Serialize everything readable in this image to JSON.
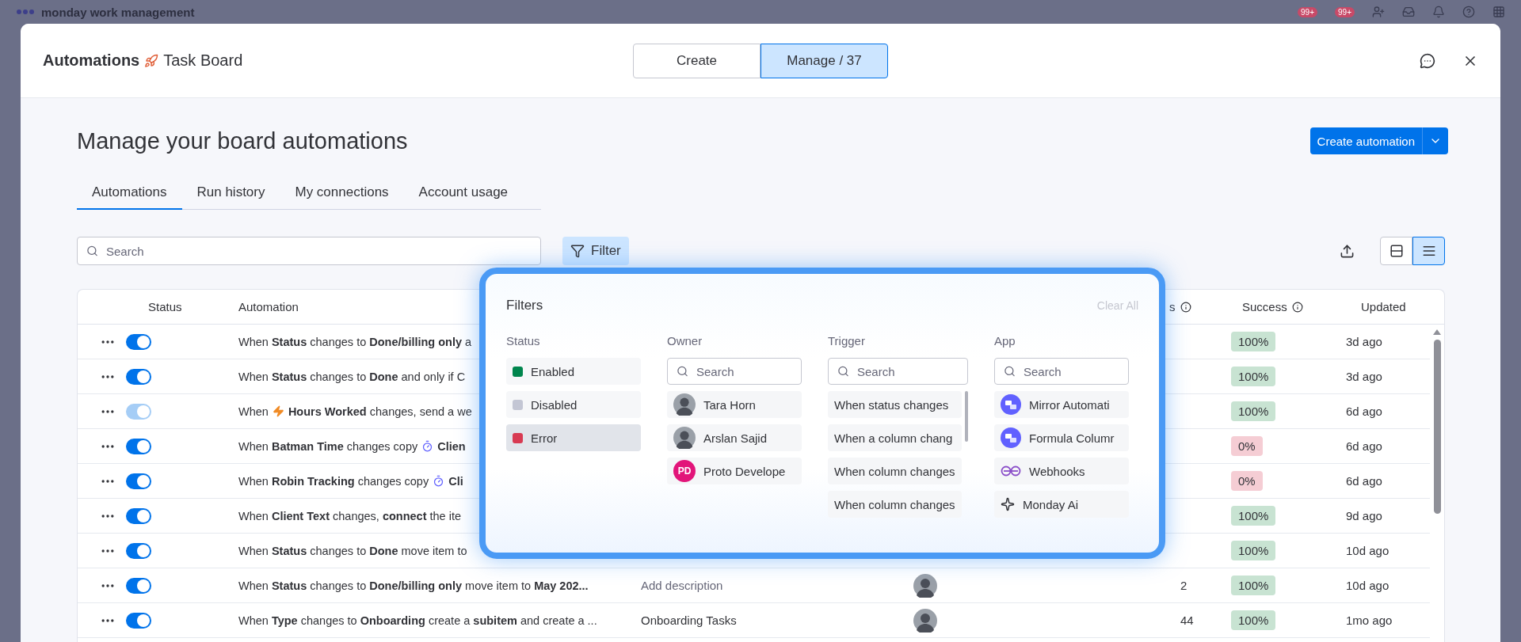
{
  "backdrop": {
    "brand": "monday work management",
    "badges": [
      "99+",
      "99+"
    ]
  },
  "window": {
    "title": "Automations",
    "board": "Task Board"
  },
  "mode_tabs": [
    {
      "label": "Create",
      "selected": false
    },
    {
      "label": "Manage / 37",
      "selected": true
    }
  ],
  "heading": "Manage your board automations",
  "create_button": "Create automation",
  "tabs": [
    {
      "label": "Automations",
      "selected": true
    },
    {
      "label": "Run history",
      "selected": false
    },
    {
      "label": "My connections",
      "selected": false
    },
    {
      "label": "Account usage",
      "selected": false
    }
  ],
  "search": {
    "placeholder": "Search"
  },
  "filter_button": {
    "label": "Filter",
    "active": true
  },
  "views": [
    {
      "kind": "cards",
      "selected": false
    },
    {
      "kind": "list",
      "selected": true
    }
  ],
  "table": {
    "columns": [
      {
        "label": "Status"
      },
      {
        "label": "Automation"
      },
      {
        "label": "s",
        "info": true
      },
      {
        "label": "Success",
        "info": true
      },
      {
        "label": "Updated"
      }
    ],
    "rows": [
      {
        "on": true,
        "disabled": false,
        "segments": [
          {
            "kind": "text",
            "text": "When **Status** changes to **Done/billing only** a"
          }
        ],
        "success": "100%",
        "color": "#c8e3d2",
        "updated": "3d ago"
      },
      {
        "on": true,
        "disabled": false,
        "segments": [
          {
            "kind": "text",
            "text": "When **Status** changes to **Done** and only if C"
          }
        ],
        "success": "100%",
        "color": "#c8e3d2",
        "updated": "3d ago"
      },
      {
        "on": true,
        "disabled": true,
        "segments": [
          {
            "kind": "text",
            "text": "When"
          },
          {
            "kind": "bolt"
          },
          {
            "kind": "text",
            "text": "**Hours Worked** changes, send a we"
          }
        ],
        "success": "100%",
        "color": "#c8e3d2",
        "updated": "6d ago"
      },
      {
        "on": true,
        "disabled": false,
        "segments": [
          {
            "kind": "text",
            "text": "When **Batman Time** changes copy"
          },
          {
            "kind": "timer"
          },
          {
            "kind": "text",
            "text": "**Clien**"
          }
        ],
        "success": "0%",
        "color": "#f5cdd4",
        "updated": "6d ago"
      },
      {
        "on": true,
        "disabled": false,
        "segments": [
          {
            "kind": "text",
            "text": "When **Robin Tracking** changes copy"
          },
          {
            "kind": "timer"
          },
          {
            "kind": "text",
            "text": "**Cli**"
          }
        ],
        "success": "0%",
        "color": "#f5cdd4",
        "updated": "6d ago"
      },
      {
        "on": true,
        "disabled": false,
        "segments": [
          {
            "kind": "text",
            "text": "When **Client Text** changes, **connect** the ite"
          }
        ],
        "success": "100%",
        "color": "#c8e3d2",
        "updated": "9d ago"
      },
      {
        "on": true,
        "disabled": false,
        "segments": [
          {
            "kind": "text",
            "text": "When **Status** changes to **Done** move item to"
          }
        ],
        "success": "100%",
        "color": "#c8e3d2",
        "updated": "10d ago"
      },
      {
        "on": true,
        "disabled": false,
        "segments": [
          {
            "kind": "text",
            "text": "When **Status** changes to **Done/billing only** move item to **May 202...**"
          }
        ],
        "description": "Add description",
        "description_placeholder": true,
        "owner_avatar": true,
        "runs": "2",
        "success": "100%",
        "color": "#c8e3d2",
        "updated": "10d ago"
      },
      {
        "on": true,
        "disabled": false,
        "segments": [
          {
            "kind": "text",
            "text": "When **Type** changes to **Onboarding** create a **subitem** and create a ..."
          }
        ],
        "description": "Onboarding Tasks",
        "description_placeholder": false,
        "owner_avatar": true,
        "runs": "44",
        "success": "100%",
        "color": "#c8e3d2",
        "updated": "1mo ago"
      }
    ]
  },
  "filters": {
    "title": "Filters",
    "clear_all": "Clear All",
    "status": {
      "label": "Status",
      "options": [
        {
          "label": "Enabled",
          "color": "#00854d",
          "selected": false
        },
        {
          "label": "Disabled",
          "color": "#c3c6d4",
          "selected": false
        },
        {
          "label": "Error",
          "color": "#d83a52",
          "selected": true
        }
      ]
    },
    "owner": {
      "label": "Owner",
      "placeholder": "Search",
      "items": [
        {
          "name": "Tara Horn",
          "kind": "photo"
        },
        {
          "name": "Arslan Sajid",
          "kind": "photo"
        },
        {
          "name": "Proto Develope",
          "kind": "initials",
          "initials": "PD",
          "color": "#e2157a"
        }
      ]
    },
    "trigger": {
      "label": "Trigger",
      "placeholder": "Search",
      "items": [
        "When status changes",
        "When a column chang",
        "When column changes",
        "When column changes"
      ]
    },
    "app": {
      "label": "App",
      "placeholder": "Search",
      "items": [
        {
          "name": "Mirror Automati",
          "kind": "app"
        },
        {
          "name": "Formula Columr",
          "kind": "app"
        },
        {
          "name": "Webhooks",
          "kind": "webhook"
        },
        {
          "name": "Monday Ai",
          "kind": "sparkle"
        }
      ]
    }
  }
}
